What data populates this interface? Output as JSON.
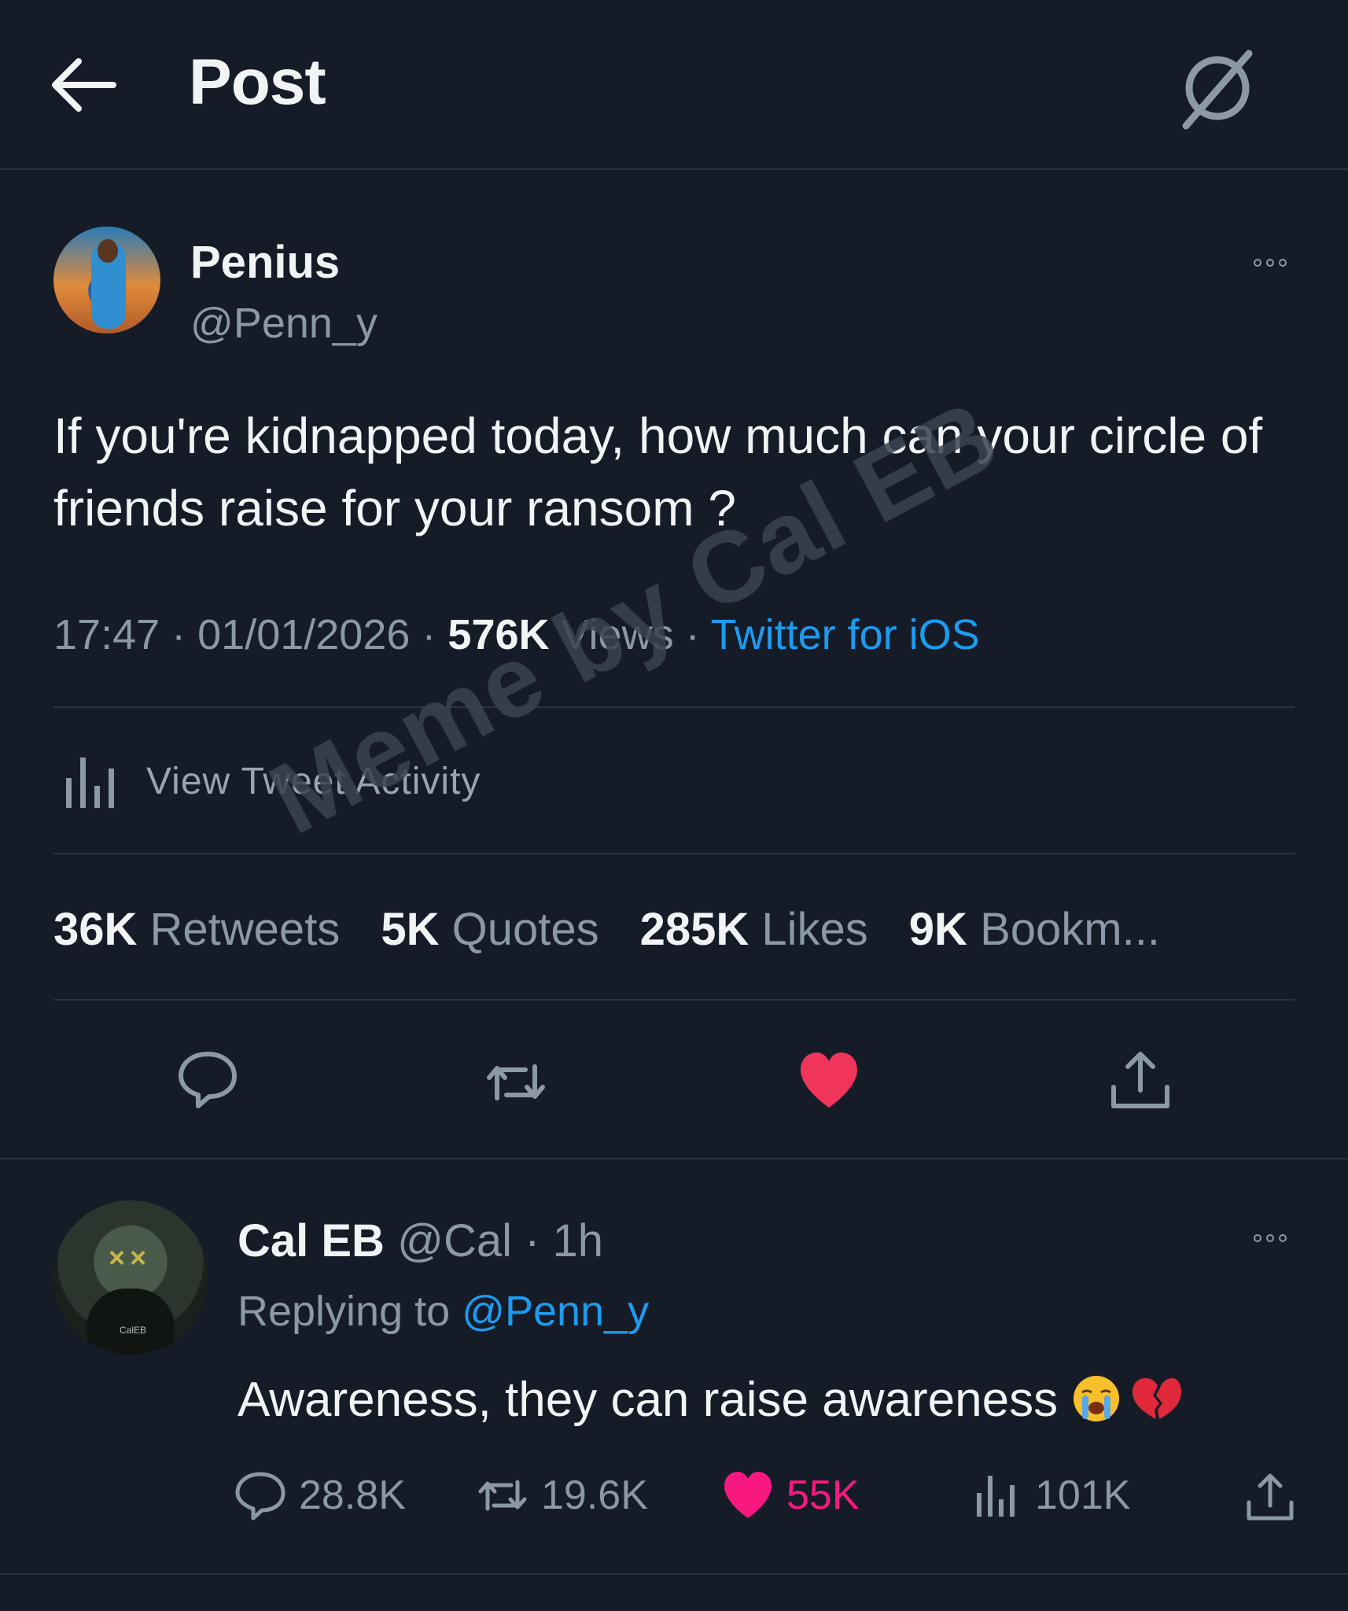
{
  "header": {
    "title": "Post",
    "back_icon": "back-arrow-icon",
    "action_icon": "sync-off-icon"
  },
  "tweet": {
    "author": {
      "name": "Penius",
      "handle": "@Penn_y"
    },
    "text": "If you're kidnapped today, how much can your circle of friends raise for your ransom ?",
    "time": "17:47",
    "date": "01/01/2026",
    "views_count": "576K",
    "views_label": "Views",
    "source": "Twitter for iOS",
    "activity_label": "View Tweet Activity",
    "stats": {
      "retweets": {
        "count": "36K",
        "label": "Retweets"
      },
      "quotes": {
        "count": "5K",
        "label": "Quotes"
      },
      "likes": {
        "count": "285K",
        "label": "Likes"
      },
      "bookmarks": {
        "count": "9K",
        "label": "Bookm..."
      }
    },
    "liked": true,
    "like_color": "#f0345a"
  },
  "watermark": "Meme by Cal EB",
  "reply": {
    "author": {
      "name": "Cal EB",
      "handle": "@Cal",
      "time": "1h"
    },
    "replying_prefix": "Replying to",
    "replying_to": "@Penn_y",
    "text": "Awareness, they can raise awareness",
    "emojis": [
      "loudly-crying-face",
      "broken-heart"
    ],
    "actions": {
      "replies": "28.8K",
      "retweets": "19.6K",
      "likes": "55K",
      "views": "101K"
    },
    "like_color": "#f91880",
    "avatar_tag": "CalEB"
  },
  "colors": {
    "background": "#151c28",
    "accent": "#1d9bf0",
    "muted": "#8b98a5"
  }
}
